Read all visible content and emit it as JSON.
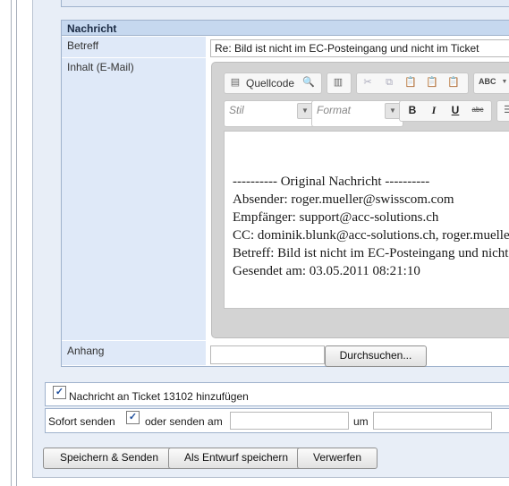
{
  "section": {
    "title": "Nachricht"
  },
  "fields": {
    "subject_label": "Betreff",
    "subject_value": "Re: Bild ist nicht im EC-Posteingang und nicht im Ticket",
    "content_label": "Inhalt (E-Mail)",
    "attachment_label": "Anhang",
    "browse_button": "Durchsuchen..."
  },
  "editor": {
    "source_label": "Quellcode",
    "style_placeholder": "Stil",
    "format_placeholder": "Format",
    "bold": "B",
    "italic": "I",
    "underline": "U",
    "strike": "abc",
    "spell": "ABC",
    "body_lines": [
      "---------- Original Nachricht ----------",
      "Absender: roger.mueller@swisscom.com",
      "Empfänger: support@acc-solutions.ch",
      "CC: dominik.blunk@acc-solutions.ch, roger.mueller",
      "Betreff: Bild ist nicht im EC-Posteingang und nicht im Ticket",
      "Gesendet am: 03.05.2011 08:21:10"
    ]
  },
  "options": {
    "add_to_ticket_checked": true,
    "add_to_ticket_label": "Nachricht an Ticket 13102 hinzufügen",
    "send_now_label": "Sofort senden",
    "send_now_checked": true,
    "or_send_at_label": "oder senden am",
    "at_label": "um",
    "date_value": "",
    "time_value": ""
  },
  "buttons": {
    "save_send": "Speichern & Senden",
    "save_draft": "Als Entwurf speichern",
    "discard": "Verwerfen"
  },
  "icons": [
    "source-icon",
    "preview-icon",
    "templates-icon",
    "cut-icon",
    "copy-icon",
    "paste-icon",
    "paste-text-icon",
    "paste-word-icon",
    "spellcheck-icon",
    "list-icon"
  ]
}
